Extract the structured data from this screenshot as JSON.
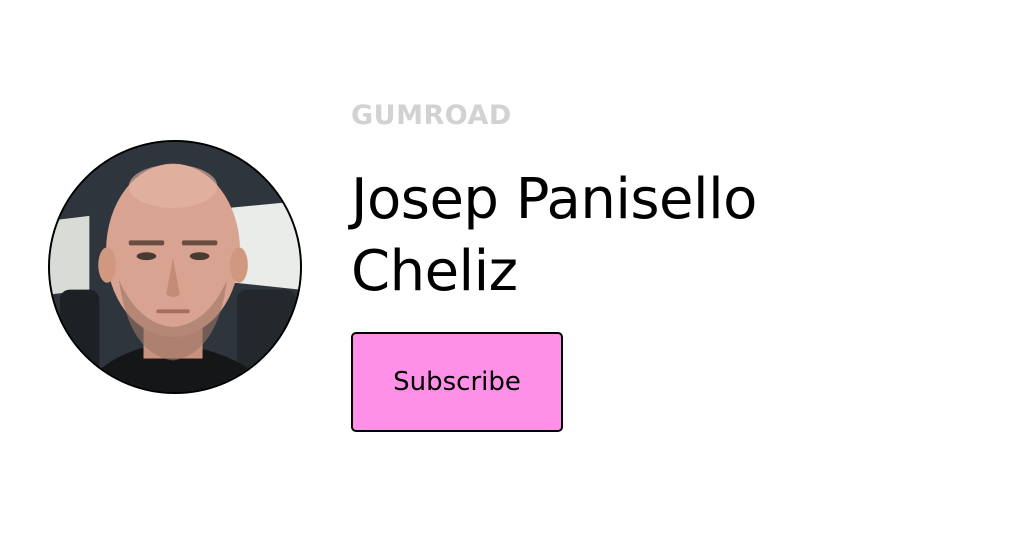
{
  "brand": {
    "logo_text": "GUMROAD",
    "logo_color": "#d2d2d2"
  },
  "profile": {
    "name": "Josep Panisello Cheliz",
    "avatar_icon": "profile-photo"
  },
  "actions": {
    "subscribe_label": "Subscribe",
    "subscribe_color": "#ff90e8"
  }
}
